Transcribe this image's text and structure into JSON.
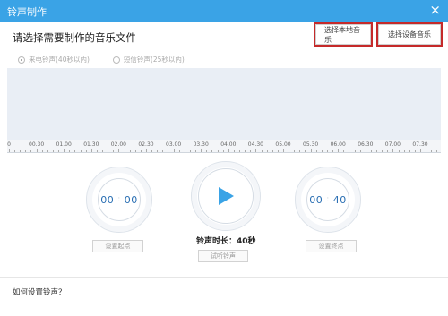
{
  "window": {
    "title": "铃声制作",
    "close_icon": "×"
  },
  "header": {
    "prompt": "请选择需要制作的音乐文件",
    "local_music_label": "选择本地音乐",
    "device_music_label": "选择设备音乐",
    "highlight_color": "#c52a2a"
  },
  "ringtone_types": [
    {
      "label": "来电铃声(40秒以内)",
      "selected": true
    },
    {
      "label": "短信铃声(25秒以内)",
      "selected": false
    }
  ],
  "timeline": {
    "ticks": [
      "0",
      "00.30",
      "01.00",
      "01.30",
      "02.00",
      "02.30",
      "03.00",
      "03.30",
      "04.00",
      "04.30",
      "05.00",
      "05.30",
      "06.00",
      "06.30",
      "07.00",
      "07.30"
    ]
  },
  "controls": {
    "start_time": {
      "minutes": "00",
      "seconds": "00"
    },
    "end_time": {
      "minutes": "00",
      "seconds": "40"
    },
    "set_start_label": "设置起点",
    "set_end_label": "设置终点",
    "duration_text": "铃声时长：40秒",
    "preview_label": "试听铃声",
    "play_icon": "play-icon",
    "accent_color": "#3aa3e6"
  },
  "footer": {
    "help_link": "如何设置铃声？"
  }
}
